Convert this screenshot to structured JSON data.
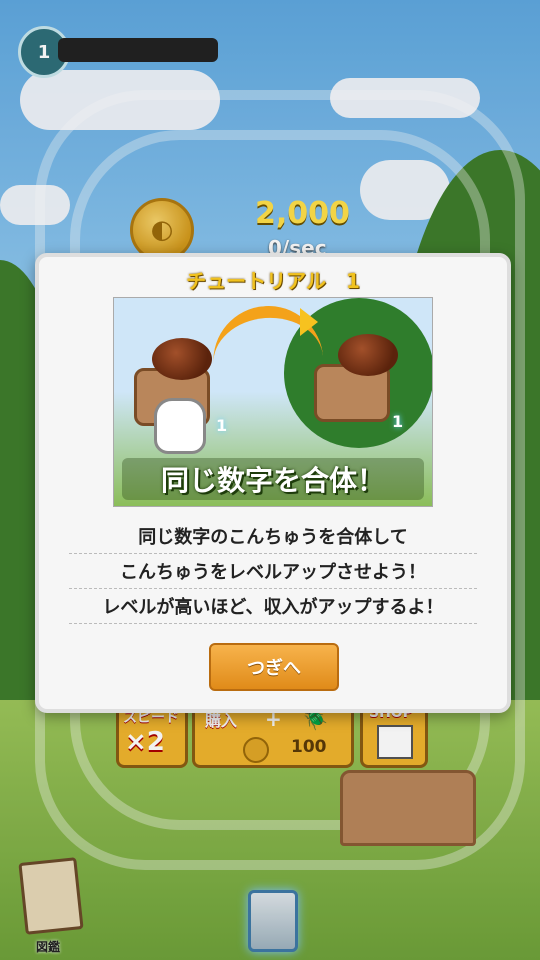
{
  "hud": {
    "level": "1",
    "money": "2,000",
    "rate": "0/sec"
  },
  "dialog": {
    "title": "チュートリアル　1",
    "image_caption": "同じ数字を合体！",
    "image_numbers": [
      "1",
      "1"
    ],
    "lines": [
      "同じ数字のこんちゅうを合体して",
      "こんちゅうをレベルアップさせよう！",
      "レベルが高いほど、収入がアップするよ！"
    ],
    "next_label": "つぎへ"
  },
  "controls": {
    "speed_label": "スピード",
    "speed_value": "×2",
    "buy_label": "購入",
    "buy_plus": "+",
    "buy_price": "100",
    "shop_label": "SHOP"
  },
  "bottom": {
    "zukan_label": "図鑑"
  },
  "icons": {
    "coin": "coin-icon",
    "beetle": "beetle-icon",
    "trash": "trash-icon",
    "book": "book-icon",
    "shop": "store-icon"
  }
}
